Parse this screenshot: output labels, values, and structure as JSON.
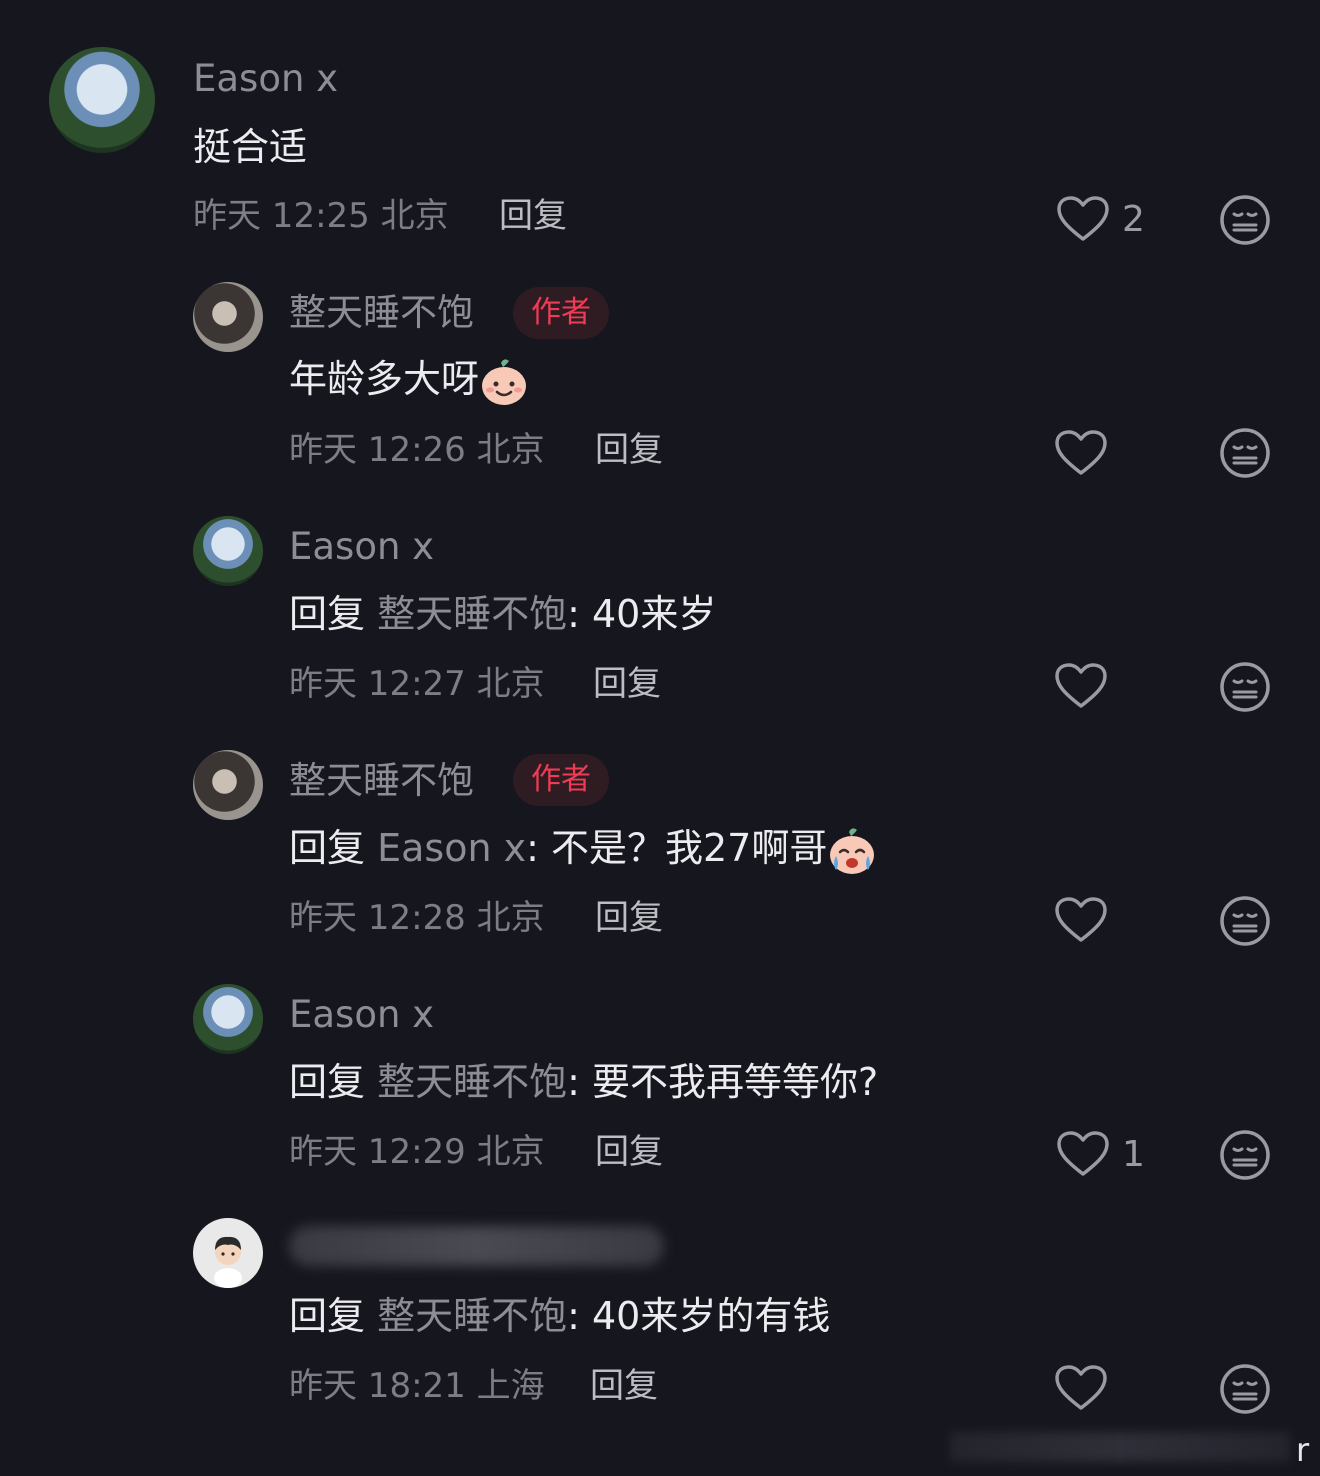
{
  "comments": [
    {
      "username": "Eason x",
      "text": "挺合适",
      "time": "昨天 12:25 北京",
      "reply_label": "回复",
      "likes": "2",
      "avatar": "messi-avatar"
    },
    {
      "username": "整天睡不饱",
      "badge": "作者",
      "text": "年龄多大呀",
      "emoji": "baby-smile-emoji",
      "time": "昨天 12:26 北京",
      "reply_label": "回复",
      "avatar": "girl-avatar"
    },
    {
      "username": "Eason x",
      "reply_prefix": "回复",
      "reply_target": "整天睡不饱",
      "text": ": 40来岁",
      "time": "昨天 12:27 北京",
      "reply_label": "回复",
      "avatar": "messi-avatar"
    },
    {
      "username": "整天睡不饱",
      "badge": "作者",
      "reply_prefix": "回复",
      "reply_target": "Eason x",
      "text": ": 不是？我27啊哥",
      "emoji": "baby-crying-emoji",
      "time": "昨天 12:28 北京",
      "reply_label": "回复",
      "avatar": "girl-avatar"
    },
    {
      "username": "Eason x",
      "reply_prefix": "回复",
      "reply_target": "整天睡不饱",
      "text": ": 要不我再等等你?",
      "time": "昨天 12:29 北京",
      "reply_label": "回复",
      "likes": "1",
      "avatar": "messi-avatar"
    },
    {
      "username": "",
      "reply_prefix": "回复",
      "reply_target": "整天睡不饱",
      "text": ": 40来岁的有钱",
      "time": "昨天 18:21 上海",
      "reply_label": "回复",
      "avatar": "boy-avatar"
    }
  ],
  "corner_char": "r",
  "colors": {
    "background": "#16161e",
    "author_badge_bg": "#2f1c22",
    "author_badge_text": "#ef3b55",
    "muted_text": "#8d8d95"
  }
}
